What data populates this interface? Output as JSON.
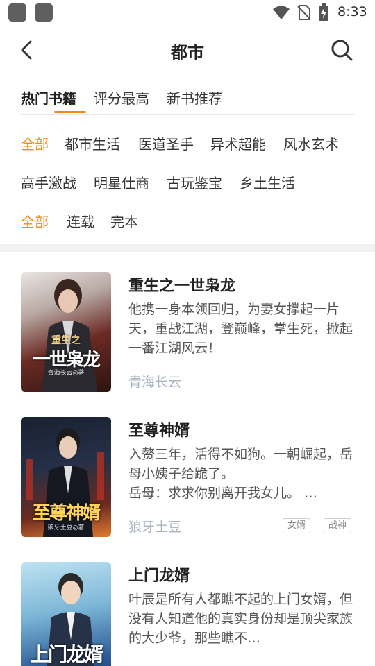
{
  "status_bar": {
    "time": "8:33",
    "icons": [
      "notification-icon",
      "notification-icon",
      "wifi-icon",
      "no-sim-icon",
      "battery-charging-icon"
    ]
  },
  "header": {
    "title": "都市",
    "back_icon": "back-arrow-icon",
    "search_icon": "search-icon"
  },
  "tabs": [
    {
      "label": "热门书籍",
      "active": true
    },
    {
      "label": "评分最高",
      "active": false
    },
    {
      "label": "新书推荐",
      "active": false
    }
  ],
  "filters": {
    "categories_row1": [
      "全部",
      "都市生活",
      "医道圣手",
      "异术超能",
      "风水玄术"
    ],
    "categories_row2": [
      "高手激战",
      "明星仕商",
      "古玩鉴宝",
      "乡土生活"
    ],
    "status": [
      "全部",
      "连载",
      "完本"
    ],
    "accent_color": "#f08a1c"
  },
  "books": [
    {
      "title": "重生之一世枭龙",
      "description": "他携一身本领回归，为妻女撑起一片天，重战江湖，登巅峰，掌生死，掀起一番江湖风云！",
      "author": "青海长云",
      "tags": [],
      "cover_title": "一世枭龙",
      "cover_subtitle": "重生之",
      "cover_author": "青海长云◎著"
    },
    {
      "title": "至尊神婿",
      "description": "入赘三年，活得不如狗。一朝崛起，岳母小姨子给跪了。\n 岳母：求求你别离开我女儿。 …",
      "author": "狼牙土豆",
      "tags": [
        "女婿",
        "战神"
      ],
      "cover_title": "至尊神婿",
      "cover_author": "狼牙土豆◎著"
    },
    {
      "title": "上门龙婿",
      "description": "叶辰是所有人都瞧不起的上门女婿，但没有人知道他的真实身份却是顶尖家族的大少爷，那些瞧不…",
      "author": "",
      "tags": [],
      "cover_title": "上门龙婿"
    }
  ]
}
